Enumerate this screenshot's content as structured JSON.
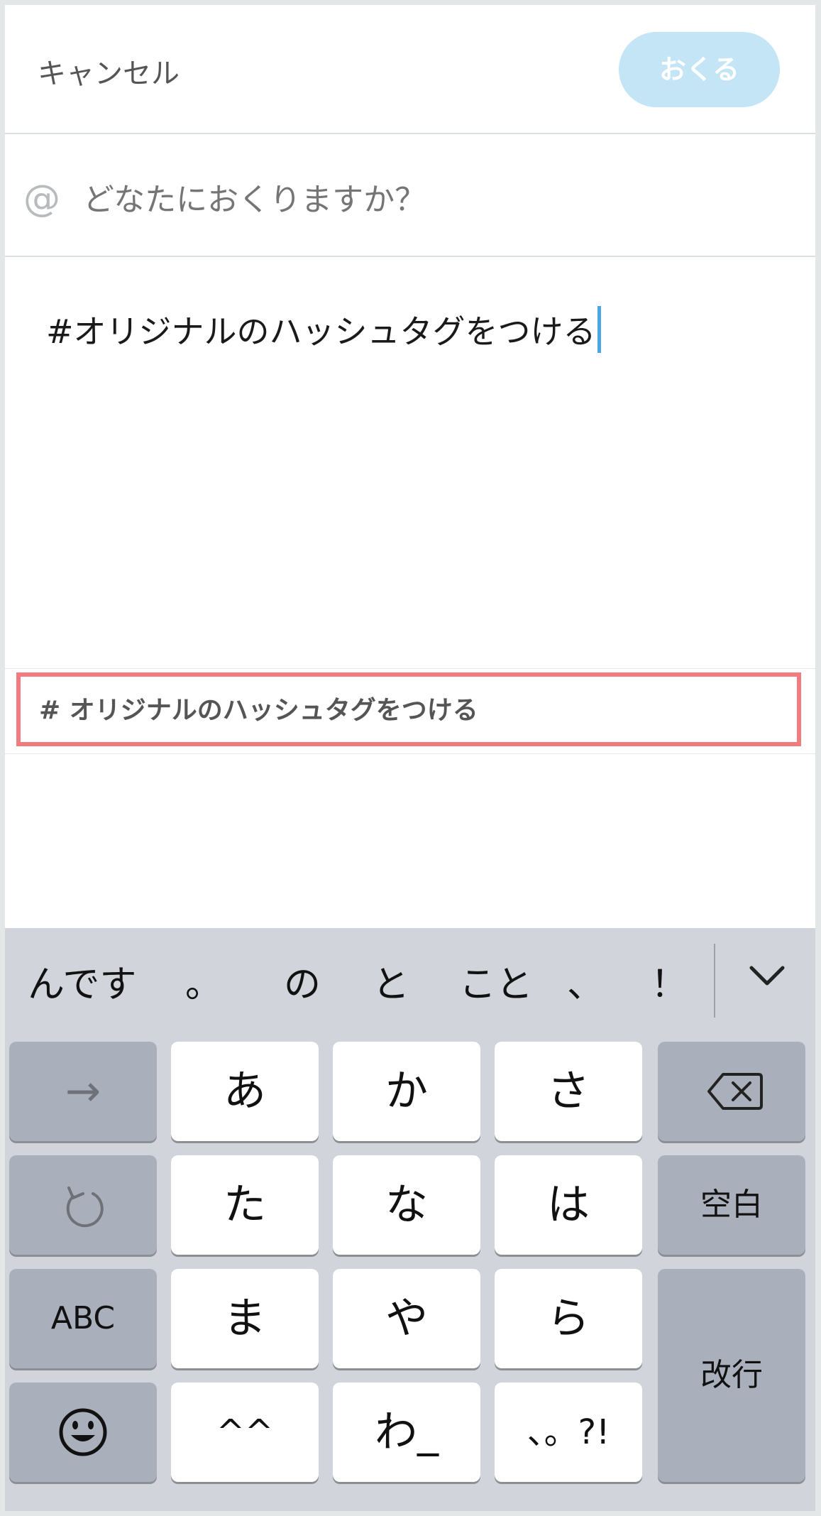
{
  "header": {
    "cancel_label": "キャンセル",
    "send_label": "おくる"
  },
  "recipient": {
    "at_symbol": "@",
    "placeholder": "どなたにおくりますか？"
  },
  "message": {
    "text": "#オリジナルのハッシュタグをつける"
  },
  "hashtag_suggestion": {
    "text": "# オリジナルのハッシュタグをつける"
  },
  "keyboard": {
    "predictions": [
      "んです",
      "。",
      "の",
      "と",
      "こと",
      "、",
      "！"
    ],
    "collapse_icon": "chevron-down-icon",
    "rows": [
      {
        "left": "→",
        "keys": [
          "あ",
          "か",
          "さ"
        ],
        "right": "backspace-icon"
      },
      {
        "left": "undo-icon",
        "keys": [
          "た",
          "な",
          "は"
        ],
        "right": "空白"
      },
      {
        "left": "ABC",
        "keys": [
          "ま",
          "や",
          "ら"
        ],
        "right": "改行"
      },
      {
        "left": "emoji-icon",
        "keys": [
          "^^",
          "わ_",
          "、。?!"
        ]
      }
    ]
  },
  "colors": {
    "accent_send_bg": "#c3e5f5",
    "caret": "#4aa6e0",
    "highlight_border": "#f27b7f",
    "keyboard_bg": "#d1d4da",
    "key_dark": "#aab0bb"
  }
}
